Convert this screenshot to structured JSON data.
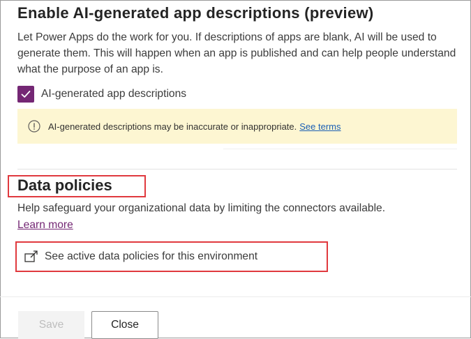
{
  "ai_section": {
    "title": "Enable AI-generated app descriptions (preview)",
    "description": "Let Power Apps do the work for you. If descriptions of apps are blank, AI will be used to generate them. This will happen when an app is published and can help people understand what the purpose of an app is.",
    "checkbox_label": "AI-generated app descriptions",
    "checkbox_checked": true,
    "notice_text": "AI-generated descriptions may be inaccurate or inappropriate.",
    "notice_link": "See terms"
  },
  "data_policies": {
    "title": "Data policies",
    "description": "Help safeguard your organizational data by limiting the connectors available.",
    "learn_more": "Learn more",
    "link_label": "See active data policies for this environment"
  },
  "footer": {
    "save_label": "Save",
    "close_label": "Close"
  },
  "colors": {
    "accent": "#742774",
    "highlight_border": "#e0393e",
    "notice_bg": "#fdf6d2",
    "link": "#1a5fb4"
  },
  "icons": {
    "checkbox": "checkmark-icon",
    "notice": "info-icon",
    "external": "open-in-new-window-icon"
  }
}
